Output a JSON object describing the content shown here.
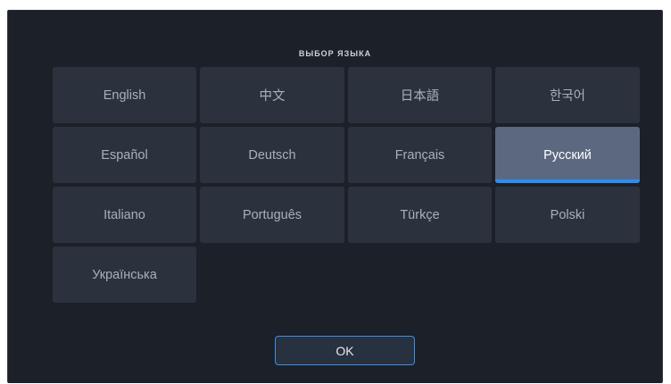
{
  "dialog": {
    "title": "ВЫБОР ЯЗЫКА",
    "ok_label": "OK",
    "selected_language": "Русский"
  },
  "languages": [
    {
      "label": "English"
    },
    {
      "label": "中文"
    },
    {
      "label": "日本語"
    },
    {
      "label": "한국어"
    },
    {
      "label": "Español"
    },
    {
      "label": "Deutsch"
    },
    {
      "label": "Français"
    },
    {
      "label": "Русский",
      "selected": true
    },
    {
      "label": "Italiano"
    },
    {
      "label": "Português"
    },
    {
      "label": "Türkçe"
    },
    {
      "label": "Polski"
    },
    {
      "label": "Українська"
    }
  ],
  "colors": {
    "background": "#1c2028",
    "tile": "#2c323d",
    "tile_selected": "#5b6880",
    "accent": "#2a8ef3"
  }
}
